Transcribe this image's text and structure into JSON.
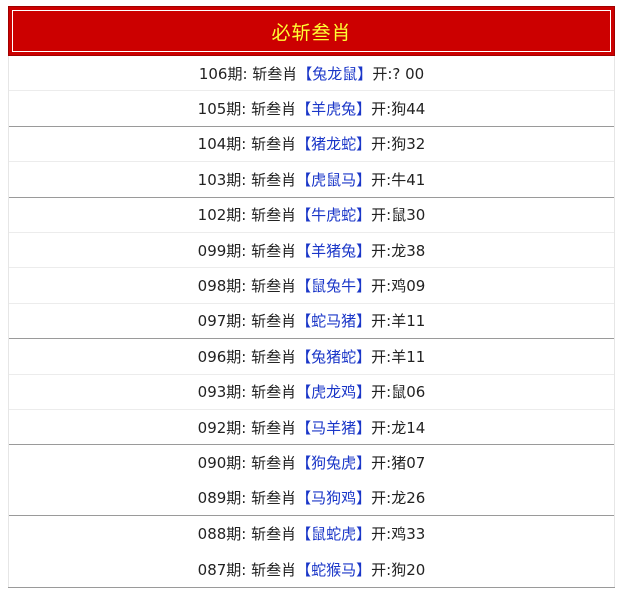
{
  "header": {
    "title": "必斩叁肖"
  },
  "rows": [
    {
      "period": "106期:",
      "label": "斩叁肖",
      "pick": "【兔龙鼠】",
      "result": "开:? 00"
    },
    {
      "period": "105期:",
      "label": "斩叁肖",
      "pick": "【羊虎兔】",
      "result": "开:狗44"
    },
    {
      "period": "104期:",
      "label": "斩叁肖",
      "pick": "【猪龙蛇】",
      "result": "开:狗32"
    },
    {
      "period": "103期:",
      "label": "斩叁肖",
      "pick": "【虎鼠马】",
      "result": "开:牛41"
    },
    {
      "period": "102期:",
      "label": "斩叁肖",
      "pick": "【牛虎蛇】",
      "result": "开:鼠30"
    },
    {
      "period": "099期:",
      "label": "斩叁肖",
      "pick": "【羊猪兔】",
      "result": "开:龙38"
    },
    {
      "period": "098期:",
      "label": "斩叁肖",
      "pick": "【鼠兔牛】",
      "result": "开:鸡09"
    },
    {
      "period": "097期:",
      "label": "斩叁肖",
      "pick": "【蛇马猪】",
      "result": "开:羊11"
    },
    {
      "period": "096期:",
      "label": "斩叁肖",
      "pick": "【兔猪蛇】",
      "result": "开:羊11"
    },
    {
      "period": "093期:",
      "label": "斩叁肖",
      "pick": "【虎龙鸡】",
      "result": "开:鼠06"
    },
    {
      "period": "092期:",
      "label": "斩叁肖",
      "pick": "【马羊猪】",
      "result": "开:龙14"
    },
    {
      "period": "090期:",
      "label": "斩叁肖",
      "pick": "【狗兔虎】",
      "result": "开:猪07"
    },
    {
      "period": "089期:",
      "label": "斩叁肖",
      "pick": "【马狗鸡】",
      "result": "开:龙26"
    },
    {
      "period": "088期:",
      "label": "斩叁肖",
      "pick": "【鼠蛇虎】",
      "result": "开:鸡33"
    },
    {
      "period": "087期:",
      "label": "斩叁肖",
      "pick": "【蛇猴马】",
      "result": "开:狗20"
    }
  ],
  "colors": {
    "header_bg": "#cc0000",
    "header_text": "#ffff33",
    "pick_text": "#1a36c8"
  }
}
